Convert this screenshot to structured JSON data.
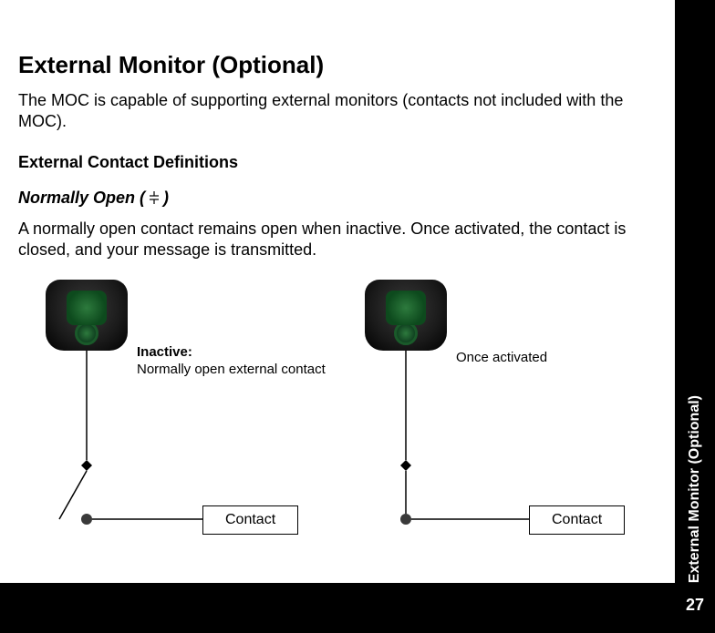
{
  "page": {
    "title": "External Monitor (Optional)",
    "intro": "The MOC is capable of supporting external monitors (contacts not included with the MOC).",
    "section_heading": "External Contact Definitions",
    "subsection_prefix": "Normally Open (",
    "subsection_suffix": ")",
    "description": "A normally open contact remains open when inactive. Once activated, the contact is closed, and your message is transmitted.",
    "side_tab": "External Monitor (Optional)",
    "page_number": "27"
  },
  "diagrams": {
    "left": {
      "caption_bold": "Inactive:",
      "caption_text": "Normally open external contact",
      "contact_label": "Contact"
    },
    "right": {
      "caption_text": "Once activated",
      "contact_label": "Contact"
    }
  }
}
